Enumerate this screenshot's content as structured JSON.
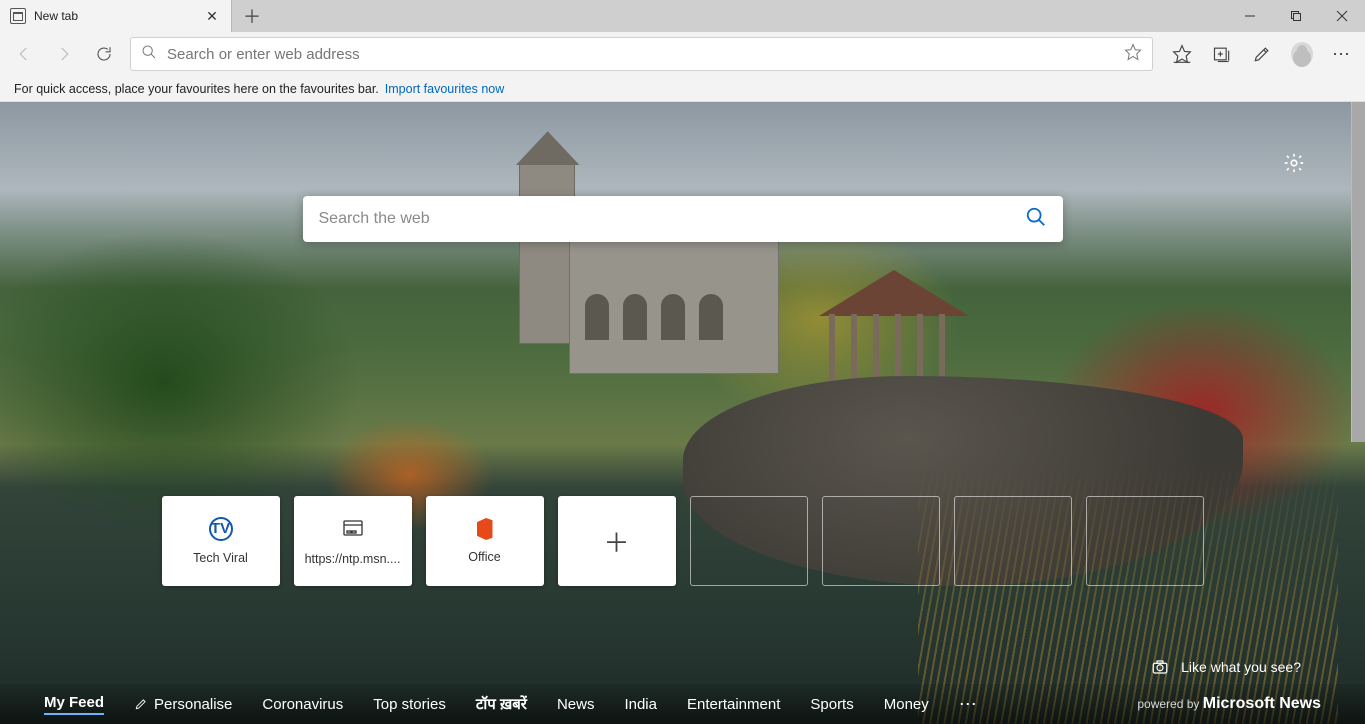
{
  "window": {
    "tab_title": "New tab"
  },
  "toolbar": {
    "address_placeholder": "Search or enter web address"
  },
  "fav_hint": {
    "text": "For quick access, place your favourites here on the favourites bar.",
    "link": "Import favourites now"
  },
  "hero": {
    "search_placeholder": "Search the web"
  },
  "tiles": [
    {
      "label": "Tech Viral",
      "icon": "tv"
    },
    {
      "label": "https://ntp.msn....",
      "icon": "globe"
    },
    {
      "label": "Office",
      "icon": "office"
    },
    {
      "label": "",
      "icon": "plus"
    }
  ],
  "like": {
    "text": "Like what you see?"
  },
  "feed": {
    "items": [
      "My Feed",
      "Personalise",
      "Coronavirus",
      "Top stories",
      "टॉप ख़बरें",
      "News",
      "India",
      "Entertainment",
      "Sports",
      "Money"
    ],
    "powered_prefix": "powered by",
    "powered_brand": "Microsoft News"
  }
}
